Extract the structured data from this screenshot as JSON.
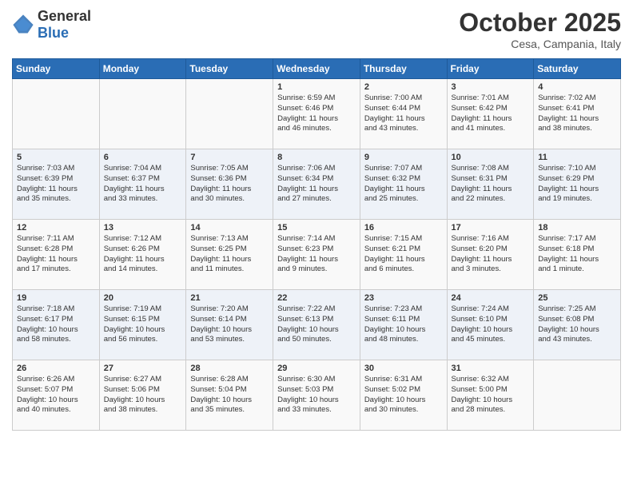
{
  "header": {
    "logo_general": "General",
    "logo_blue": "Blue",
    "month_title": "October 2025",
    "location": "Cesa, Campania, Italy"
  },
  "days_of_week": [
    "Sunday",
    "Monday",
    "Tuesday",
    "Wednesday",
    "Thursday",
    "Friday",
    "Saturday"
  ],
  "weeks": [
    [
      {
        "day": "",
        "info": ""
      },
      {
        "day": "",
        "info": ""
      },
      {
        "day": "",
        "info": ""
      },
      {
        "day": "1",
        "info": "Sunrise: 6:59 AM\nSunset: 6:46 PM\nDaylight: 11 hours\nand 46 minutes."
      },
      {
        "day": "2",
        "info": "Sunrise: 7:00 AM\nSunset: 6:44 PM\nDaylight: 11 hours\nand 43 minutes."
      },
      {
        "day": "3",
        "info": "Sunrise: 7:01 AM\nSunset: 6:42 PM\nDaylight: 11 hours\nand 41 minutes."
      },
      {
        "day": "4",
        "info": "Sunrise: 7:02 AM\nSunset: 6:41 PM\nDaylight: 11 hours\nand 38 minutes."
      }
    ],
    [
      {
        "day": "5",
        "info": "Sunrise: 7:03 AM\nSunset: 6:39 PM\nDaylight: 11 hours\nand 35 minutes."
      },
      {
        "day": "6",
        "info": "Sunrise: 7:04 AM\nSunset: 6:37 PM\nDaylight: 11 hours\nand 33 minutes."
      },
      {
        "day": "7",
        "info": "Sunrise: 7:05 AM\nSunset: 6:36 PM\nDaylight: 11 hours\nand 30 minutes."
      },
      {
        "day": "8",
        "info": "Sunrise: 7:06 AM\nSunset: 6:34 PM\nDaylight: 11 hours\nand 27 minutes."
      },
      {
        "day": "9",
        "info": "Sunrise: 7:07 AM\nSunset: 6:32 PM\nDaylight: 11 hours\nand 25 minutes."
      },
      {
        "day": "10",
        "info": "Sunrise: 7:08 AM\nSunset: 6:31 PM\nDaylight: 11 hours\nand 22 minutes."
      },
      {
        "day": "11",
        "info": "Sunrise: 7:10 AM\nSunset: 6:29 PM\nDaylight: 11 hours\nand 19 minutes."
      }
    ],
    [
      {
        "day": "12",
        "info": "Sunrise: 7:11 AM\nSunset: 6:28 PM\nDaylight: 11 hours\nand 17 minutes."
      },
      {
        "day": "13",
        "info": "Sunrise: 7:12 AM\nSunset: 6:26 PM\nDaylight: 11 hours\nand 14 minutes."
      },
      {
        "day": "14",
        "info": "Sunrise: 7:13 AM\nSunset: 6:25 PM\nDaylight: 11 hours\nand 11 minutes."
      },
      {
        "day": "15",
        "info": "Sunrise: 7:14 AM\nSunset: 6:23 PM\nDaylight: 11 hours\nand 9 minutes."
      },
      {
        "day": "16",
        "info": "Sunrise: 7:15 AM\nSunset: 6:21 PM\nDaylight: 11 hours\nand 6 minutes."
      },
      {
        "day": "17",
        "info": "Sunrise: 7:16 AM\nSunset: 6:20 PM\nDaylight: 11 hours\nand 3 minutes."
      },
      {
        "day": "18",
        "info": "Sunrise: 7:17 AM\nSunset: 6:18 PM\nDaylight: 11 hours\nand 1 minute."
      }
    ],
    [
      {
        "day": "19",
        "info": "Sunrise: 7:18 AM\nSunset: 6:17 PM\nDaylight: 10 hours\nand 58 minutes."
      },
      {
        "day": "20",
        "info": "Sunrise: 7:19 AM\nSunset: 6:15 PM\nDaylight: 10 hours\nand 56 minutes."
      },
      {
        "day": "21",
        "info": "Sunrise: 7:20 AM\nSunset: 6:14 PM\nDaylight: 10 hours\nand 53 minutes."
      },
      {
        "day": "22",
        "info": "Sunrise: 7:22 AM\nSunset: 6:13 PM\nDaylight: 10 hours\nand 50 minutes."
      },
      {
        "day": "23",
        "info": "Sunrise: 7:23 AM\nSunset: 6:11 PM\nDaylight: 10 hours\nand 48 minutes."
      },
      {
        "day": "24",
        "info": "Sunrise: 7:24 AM\nSunset: 6:10 PM\nDaylight: 10 hours\nand 45 minutes."
      },
      {
        "day": "25",
        "info": "Sunrise: 7:25 AM\nSunset: 6:08 PM\nDaylight: 10 hours\nand 43 minutes."
      }
    ],
    [
      {
        "day": "26",
        "info": "Sunrise: 6:26 AM\nSunset: 5:07 PM\nDaylight: 10 hours\nand 40 minutes."
      },
      {
        "day": "27",
        "info": "Sunrise: 6:27 AM\nSunset: 5:06 PM\nDaylight: 10 hours\nand 38 minutes."
      },
      {
        "day": "28",
        "info": "Sunrise: 6:28 AM\nSunset: 5:04 PM\nDaylight: 10 hours\nand 35 minutes."
      },
      {
        "day": "29",
        "info": "Sunrise: 6:30 AM\nSunset: 5:03 PM\nDaylight: 10 hours\nand 33 minutes."
      },
      {
        "day": "30",
        "info": "Sunrise: 6:31 AM\nSunset: 5:02 PM\nDaylight: 10 hours\nand 30 minutes."
      },
      {
        "day": "31",
        "info": "Sunrise: 6:32 AM\nSunset: 5:00 PM\nDaylight: 10 hours\nand 28 minutes."
      },
      {
        "day": "",
        "info": ""
      }
    ]
  ]
}
